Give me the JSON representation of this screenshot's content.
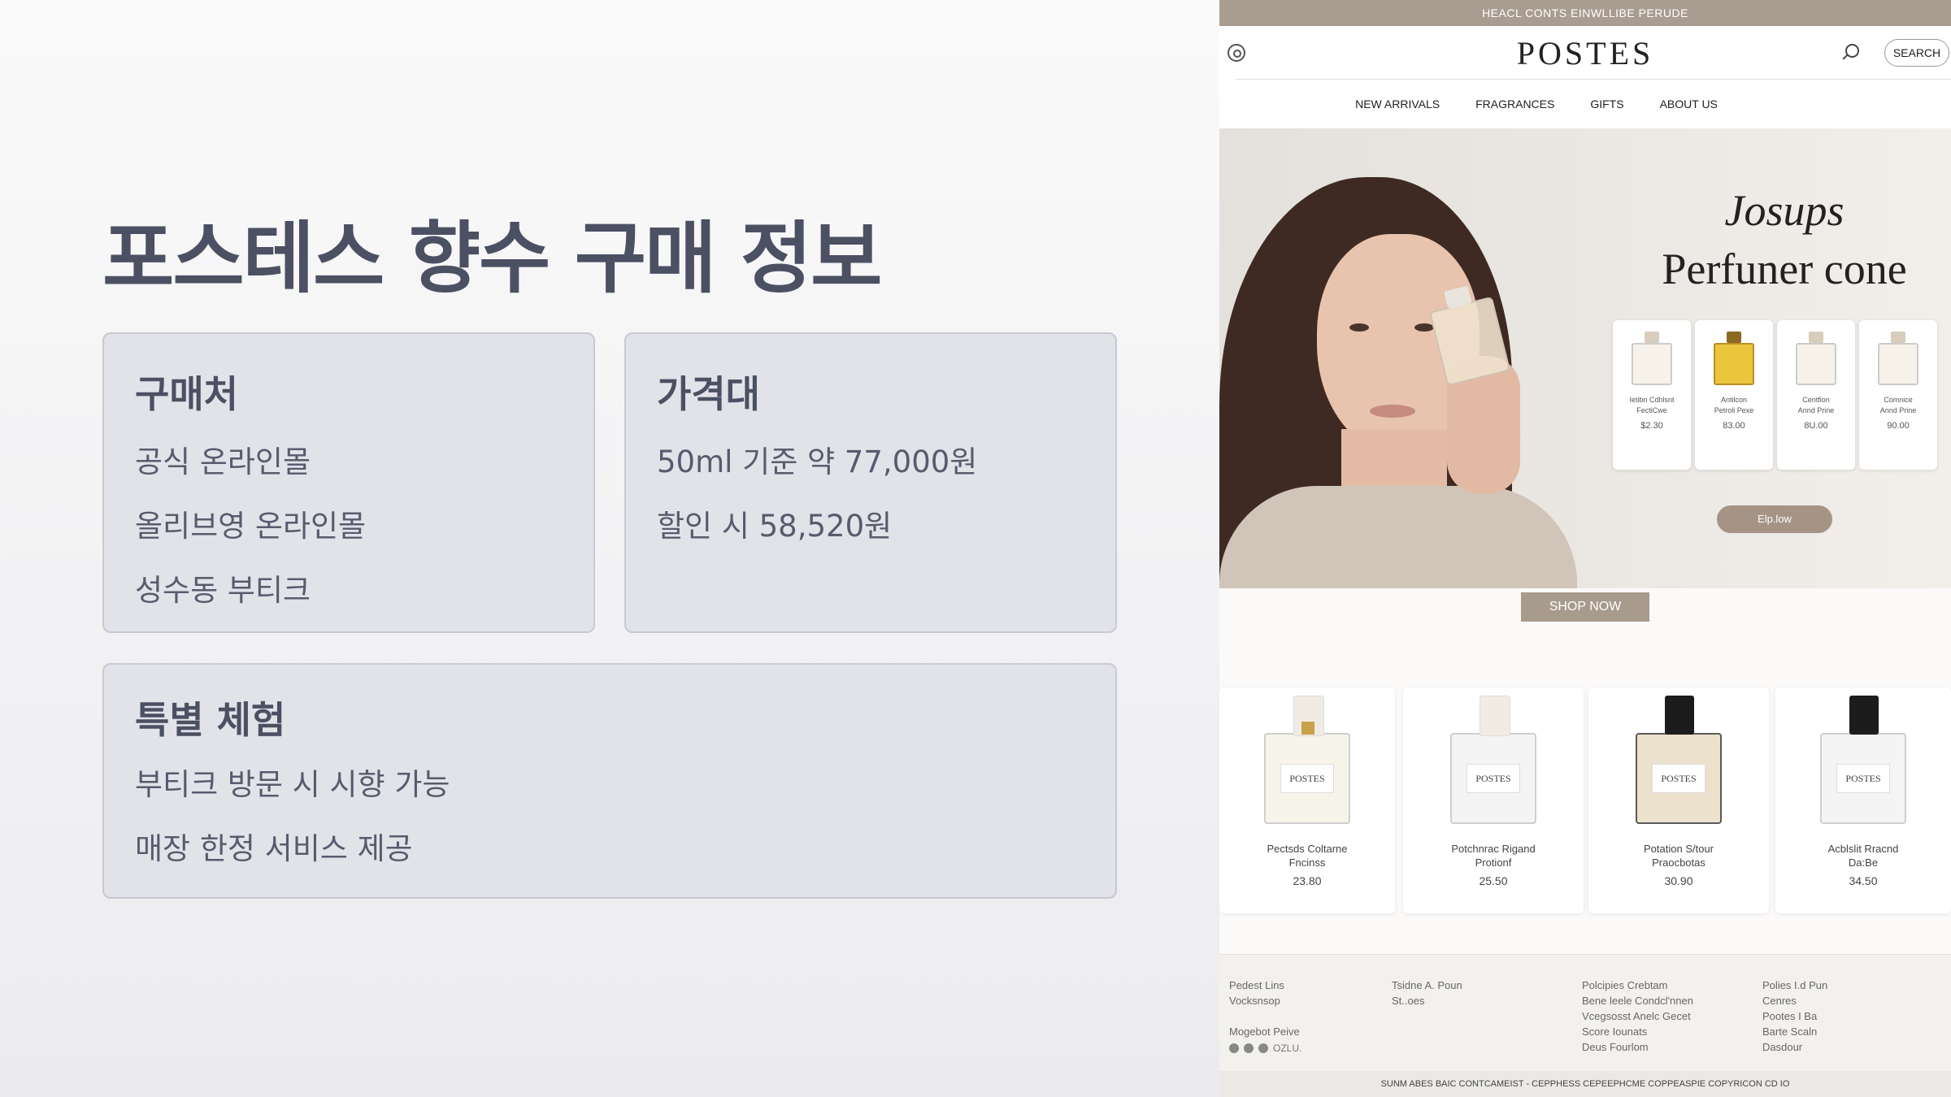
{
  "slide": {
    "title": "포스테스 향수 구매 정보",
    "cards": [
      {
        "heading": "구매처",
        "lines": [
          "공식 온라인몰",
          "올리브영 온라인몰",
          "성수동 부티크"
        ]
      },
      {
        "heading": "가격대",
        "lines": [
          "50ml 기준 약 77,000원",
          "할인 시 58,520원"
        ]
      },
      {
        "heading": "특별 체험",
        "lines": [
          "부티크 방문 시 시향 가능",
          "매장 한정 서비스 제공"
        ]
      }
    ]
  },
  "website": {
    "announcement": "HEACL CONTS EINWLLIBE PERUDE",
    "logo": "POSTES",
    "search_label": "SEARCH",
    "nav": [
      "NEW ARRIVALS",
      "FRAGRANCES",
      "GIFTS",
      "ABOUT US"
    ],
    "hero": {
      "title_line1": "Josups",
      "title_line2": "Perfuner cone",
      "mini_products": [
        {
          "name": "Ietibn Cdhlsnt\nFectiCwe",
          "price": "$2.30"
        },
        {
          "name": "Antilcon\nPetroli Pexe",
          "price": "83.00"
        },
        {
          "name": "Centfion\nAnnd Prine",
          "price": "8U.00"
        },
        {
          "name": "Comnice\nAnnd Prine",
          "price": "90.00"
        }
      ],
      "explore_label": "Elp.low"
    },
    "shop_now_label": "SHOP NOW",
    "products": [
      {
        "name": "Pectsds Coltarne\nFncinss",
        "price": "23.80",
        "bottle_label": "POSTES"
      },
      {
        "name": "Potchnrac Rigand\nProtionf",
        "price": "25.50",
        "bottle_label": "POSTES"
      },
      {
        "name": "Potation S/tour\nPraocbotas",
        "price": "30.90",
        "bottle_label": "POSTES"
      },
      {
        "name": "Acblslit Rracnd\nDa:Be",
        "price": "34.50",
        "bottle_label": "POSTES"
      }
    ],
    "footer": {
      "col1": "Pedest Lins\nVocksnsop\n\nMogebot Peive",
      "col2": "Tsidne A. Poun\nSt..oes",
      "col3": "Polcipies Crebtam\nBene leele Condcl'nnen\nVcegsosst Anelc Gecet\nScore Iounats\nDeus Fourlom",
      "col4": "Polies I.d Pun\nCenres\nPootes I Ba\nBarte Scaln\nDasdour",
      "social_text": "OZLU.",
      "bottom": "SUNM ABES    BAIC CONTCAMEIST - CEPPHESS CEPEEPHCME COPPEASPIE    COPYRICON CD IO"
    }
  }
}
